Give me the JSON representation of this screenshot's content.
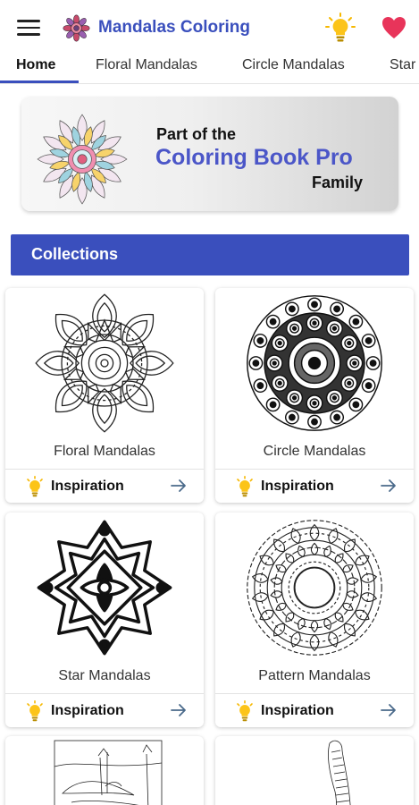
{
  "app": {
    "title": "Mandalas Coloring",
    "accent_color": "#3a4fbd",
    "icons": {
      "menu": "hamburger-menu-icon",
      "logo": "mandala-logo-icon",
      "tips": "lightbulb-icon",
      "favorites": "heart-icon"
    }
  },
  "tabs": [
    {
      "label": "Home",
      "active": true
    },
    {
      "label": "Floral Mandalas",
      "active": false
    },
    {
      "label": "Circle Mandalas",
      "active": false
    },
    {
      "label": "Star",
      "active": false
    }
  ],
  "promo": {
    "line1": "Part of the",
    "line2": "Coloring Book Pro",
    "line3": "Family"
  },
  "collections": {
    "heading": "Collections",
    "items": [
      {
        "title": "Floral Mandalas",
        "action": "Inspiration",
        "image": "floral-mandala"
      },
      {
        "title": "Circle Mandalas",
        "action": "Inspiration",
        "image": "circle-mandala"
      },
      {
        "title": "Star Mandalas",
        "action": "Inspiration",
        "image": "star-mandala"
      },
      {
        "title": "Pattern Mandalas",
        "action": "Inspiration",
        "image": "pattern-mandala"
      },
      {
        "title": "",
        "action": "",
        "image": "landscape-sketch"
      },
      {
        "title": "",
        "action": "",
        "image": "feather-sketch"
      }
    ]
  }
}
